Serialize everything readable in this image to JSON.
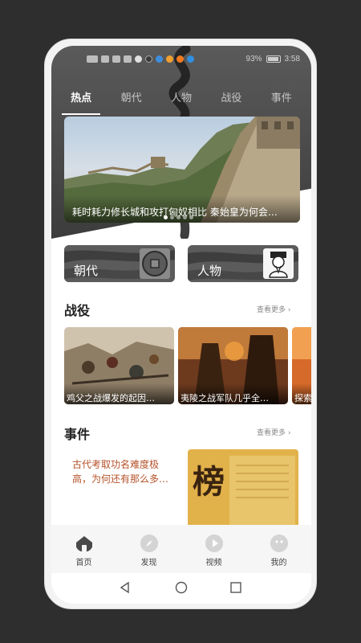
{
  "status_bar": {
    "battery_percent": "93%",
    "time": "3:58"
  },
  "tabs": [
    {
      "label": "热点",
      "active": true
    },
    {
      "label": "朝代",
      "active": false
    },
    {
      "label": "人物",
      "active": false
    },
    {
      "label": "战役",
      "active": false
    },
    {
      "label": "事件",
      "active": false
    }
  ],
  "banner": {
    "caption": "耗时耗力修长城和攻打匈奴相比 秦始皇为何会…",
    "dot_count": 5,
    "active_dot": 0
  },
  "categories": [
    {
      "label": "朝代",
      "icon": "coin-icon"
    },
    {
      "label": "人物",
      "icon": "portrait-icon"
    }
  ],
  "battles": {
    "title": "战役",
    "see_more": "查看更多",
    "items": [
      {
        "caption": "鸡父之战爆发的起因…"
      },
      {
        "caption": "夷陵之战军队几乎全…"
      },
      {
        "caption": "探索"
      }
    ]
  },
  "events": {
    "title": "事件",
    "see_more": "查看更多",
    "items": [
      {
        "text": "古代考取功名难度极高，为何还有那么多…",
        "image_char": "榜"
      }
    ]
  },
  "bottom_nav": [
    {
      "label": "首页",
      "icon": "home-icon",
      "active": true
    },
    {
      "label": "发现",
      "icon": "compass-icon",
      "active": false
    },
    {
      "label": "视频",
      "icon": "play-icon",
      "active": false
    },
    {
      "label": "我的",
      "icon": "profile-icon",
      "active": false
    }
  ],
  "colors": {
    "accent_text": "#b5522a",
    "header_bg": "#4a4a4a"
  }
}
